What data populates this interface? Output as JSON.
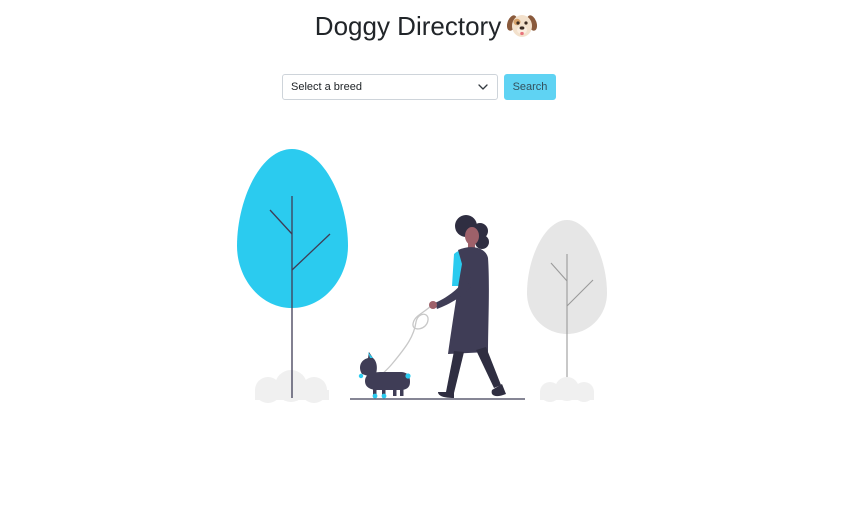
{
  "header": {
    "title": "Doggy Directory",
    "title_emoji": "dog-face-emoji"
  },
  "search": {
    "select_value": "Select a breed",
    "button_label": "Search"
  },
  "illustration": {
    "description_icon": "woman-walking-dog-illustration"
  },
  "colors": {
    "accent": "#5fd3f3",
    "tree_blue": "#2bcbef",
    "tree_gray": "#e6e6e6",
    "figure_dark": "#3f3d56",
    "text": "#212529"
  }
}
